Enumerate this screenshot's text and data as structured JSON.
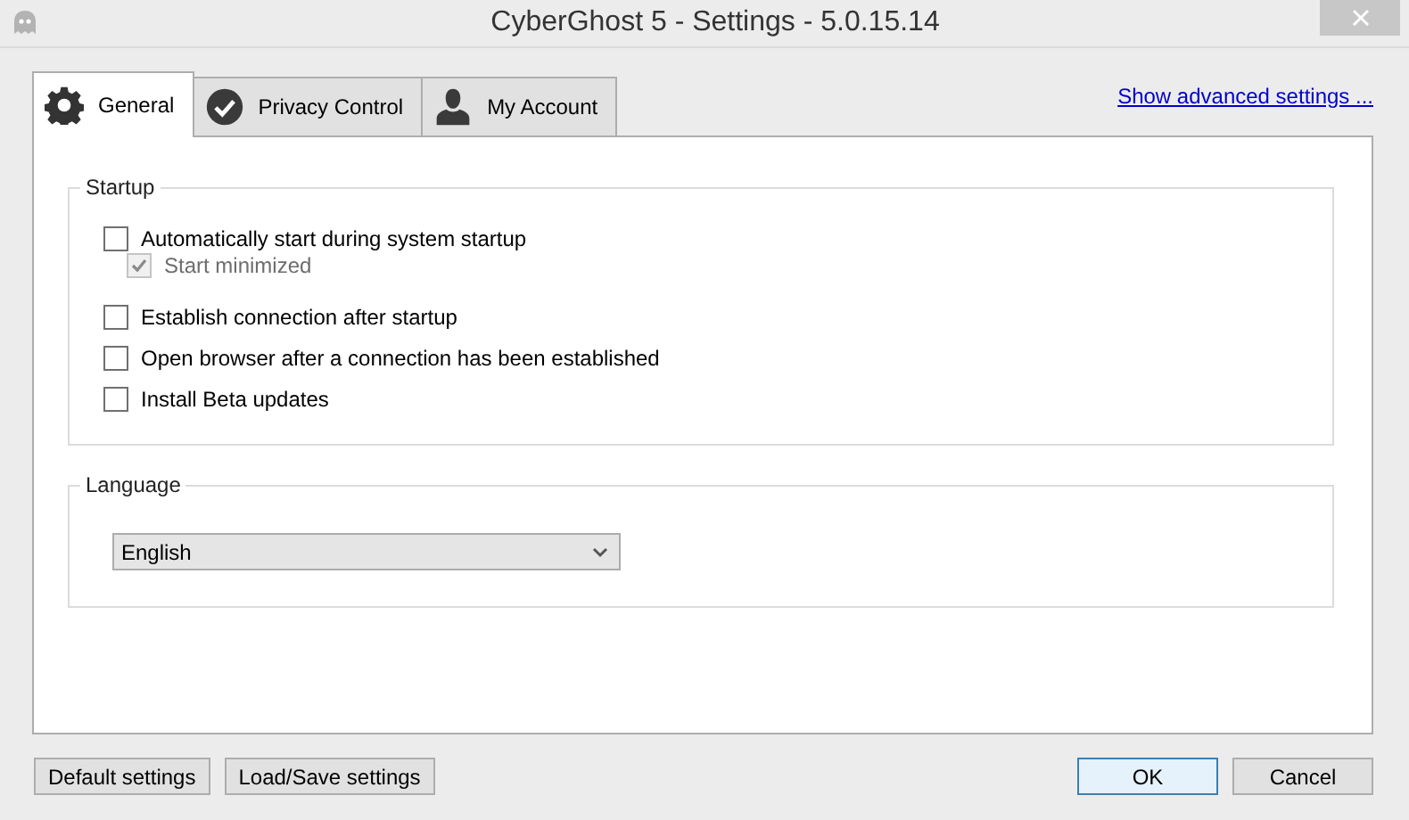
{
  "window": {
    "title": "CyberGhost 5 - Settings - 5.0.15.14"
  },
  "tabs": [
    {
      "label": "General",
      "selected": true
    },
    {
      "label": "Privacy Control",
      "selected": false
    },
    {
      "label": "My Account",
      "selected": false
    }
  ],
  "advanced_link": "Show advanced settings ...",
  "startup": {
    "title": "Startup",
    "options": [
      {
        "label": "Automatically start during system startup",
        "checked": false,
        "disabled": false,
        "children": [
          {
            "label": "Start minimized",
            "checked": true,
            "disabled": true
          }
        ]
      },
      {
        "label": "Establish connection after startup",
        "checked": false,
        "disabled": false
      },
      {
        "label": "Open browser after a connection has been established",
        "checked": false,
        "disabled": false
      },
      {
        "label": "Install Beta updates",
        "checked": false,
        "disabled": false
      }
    ]
  },
  "language": {
    "title": "Language",
    "value": "English"
  },
  "buttons": [
    {
      "label": "Default settings",
      "default": false
    },
    {
      "label": "Load/Save settings",
      "default": false
    },
    {
      "label": "OK",
      "default": true
    },
    {
      "label": "Cancel",
      "default": false
    }
  ]
}
